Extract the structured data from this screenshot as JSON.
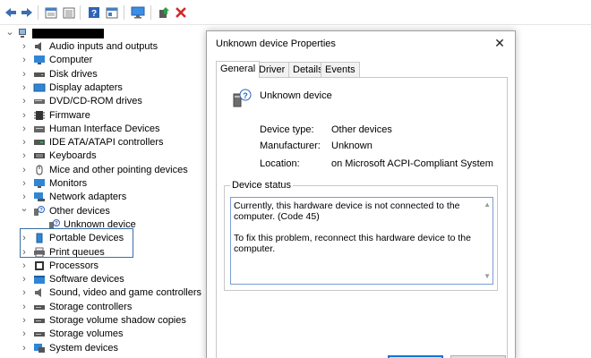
{
  "toolbar": {
    "buttons": [
      "back-icon",
      "forward-icon",
      "properties-icon",
      "show-hidden-icon",
      "help-icon",
      "action-pane-icon",
      "monitor-icon",
      "update-driver-icon",
      "uninstall-icon"
    ]
  },
  "tree": {
    "root_label": "",
    "items": [
      {
        "label": "Audio inputs and outputs",
        "icon": "speaker-icon"
      },
      {
        "label": "Computer",
        "icon": "computer-icon"
      },
      {
        "label": "Disk drives",
        "icon": "disk-icon"
      },
      {
        "label": "Display adapters",
        "icon": "display-icon"
      },
      {
        "label": "DVD/CD-ROM drives",
        "icon": "dvd-icon"
      },
      {
        "label": "Firmware",
        "icon": "firmware-icon"
      },
      {
        "label": "Human Interface Devices",
        "icon": "hid-icon"
      },
      {
        "label": "IDE ATA/ATAPI controllers",
        "icon": "ide-icon"
      },
      {
        "label": "Keyboards",
        "icon": "keyboard-icon"
      },
      {
        "label": "Mice and other pointing devices",
        "icon": "mouse-icon"
      },
      {
        "label": "Monitors",
        "icon": "monitor-icon"
      },
      {
        "label": "Network adapters",
        "icon": "network-icon"
      },
      {
        "label": "Other devices",
        "icon": "unknown-device-icon"
      },
      {
        "label": "Unknown device",
        "icon": "unknown-device-icon"
      },
      {
        "label": "Portable Devices",
        "icon": "portable-icon"
      },
      {
        "label": "Print queues",
        "icon": "printer-icon"
      },
      {
        "label": "Processors",
        "icon": "processor-icon"
      },
      {
        "label": "Software devices",
        "icon": "software-icon"
      },
      {
        "label": "Sound, video and game controllers",
        "icon": "sound-icon"
      },
      {
        "label": "Storage controllers",
        "icon": "storage-icon"
      },
      {
        "label": "Storage volume shadow copies",
        "icon": "storage-icon"
      },
      {
        "label": "Storage volumes",
        "icon": "storage-icon"
      },
      {
        "label": "System devices",
        "icon": "system-icon"
      }
    ]
  },
  "dialog": {
    "title": "Unknown device Properties",
    "close": "✕",
    "tabs": [
      "General",
      "Driver",
      "Details",
      "Events"
    ],
    "device_name": "Unknown device",
    "props": [
      {
        "label": "Device type:",
        "value": "Other devices"
      },
      {
        "label": "Manufacturer:",
        "value": "Unknown"
      },
      {
        "label": "Location:",
        "value": "on Microsoft ACPI-Compliant System"
      }
    ],
    "status_legend": "Device status",
    "status_p1": "Currently, this hardware device is not connected to the computer. (Code 45)",
    "status_p2": "To fix this problem, reconnect this hardware device to the computer."
  },
  "colors": {
    "selection_border": "#3a6ea5",
    "status_border": "#7a9cd3",
    "uninstall_red": "#d4272b",
    "accent": "#0078d7"
  }
}
